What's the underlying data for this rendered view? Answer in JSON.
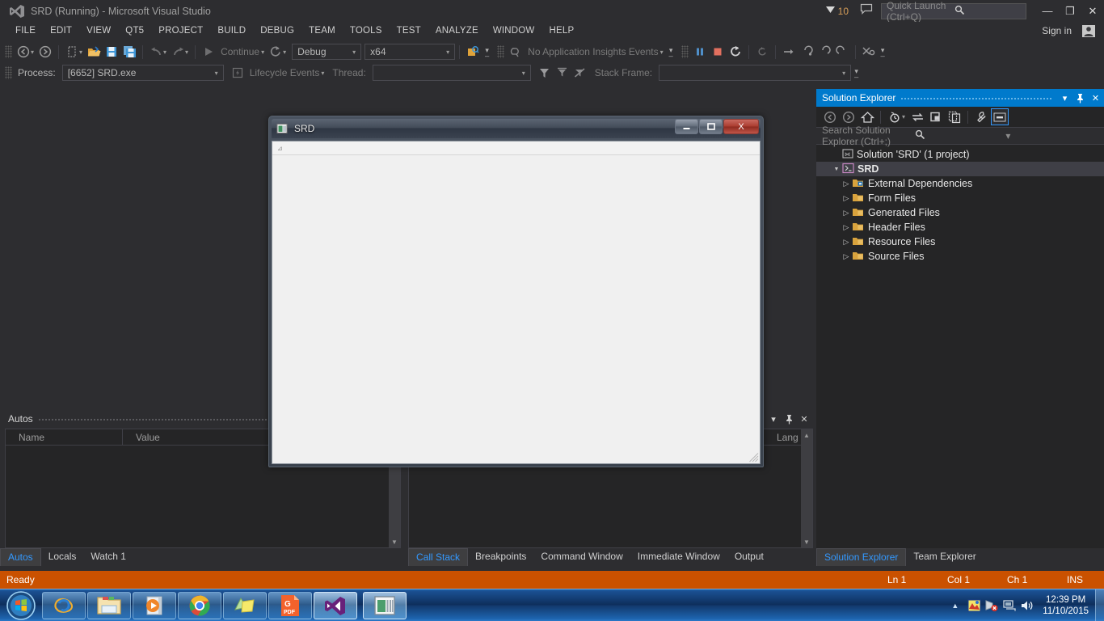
{
  "window": {
    "title": "SRD (Running) - Microsoft Visual Studio",
    "logo_icon": "visual-studio-logo",
    "minimize_label": "—",
    "maximize_label": "❐",
    "close_label": "✕"
  },
  "titlebar_right": {
    "feedback_icon": "megaphone-icon",
    "feedback_count": "10",
    "comment_icon": "comment-icon",
    "quick_launch_placeholder": "Quick Launch (Ctrl+Q)",
    "search_icon": "search-icon"
  },
  "menubar": {
    "items": [
      {
        "label": "FILE"
      },
      {
        "label": "EDIT"
      },
      {
        "label": "VIEW"
      },
      {
        "label": "QT5"
      },
      {
        "label": "PROJECT"
      },
      {
        "label": "BUILD"
      },
      {
        "label": "DEBUG"
      },
      {
        "label": "TEAM"
      },
      {
        "label": "TOOLS"
      },
      {
        "label": "TEST"
      },
      {
        "label": "ANALYZE"
      },
      {
        "label": "WINDOW"
      },
      {
        "label": "HELP"
      }
    ],
    "sign_in": "Sign in",
    "account_icon": "account-icon"
  },
  "toolbar_standard": {
    "nav_back_icon": "navigate-back-icon",
    "nav_forward_icon": "navigate-forward-icon",
    "new_item_icon": "new-item-icon",
    "open_file_icon": "open-file-icon",
    "save_icon": "save-icon",
    "save_all_icon": "save-all-icon",
    "undo_icon": "undo-icon",
    "redo_icon": "redo-icon",
    "run_icon": "play-icon",
    "continue_label": "Continue",
    "restart_icon": "restart-icon",
    "configuration": "Debug",
    "platform": "x64",
    "intellitrace_icon": "intellitrace-icon",
    "app_insights_icon": "app-insights-icon",
    "app_insights_label": "No Application Insights Events",
    "break_all_icon": "pause-icon",
    "stop_debugging_icon": "stop-icon",
    "restart_debug_icon": "restart-debug-icon",
    "show_next_statement_icon": "show-next-statement-icon",
    "step_into_icon": "step-into-icon",
    "step_over_icon": "step-over-icon",
    "step_out_icon": "step-out-icon",
    "thread_marker_icon": "thread-marker-icon",
    "overflow_icon": "toolbar-overflow-icon"
  },
  "toolbar_debug": {
    "process_label": "Process:",
    "process_value": "[6652] SRD.exe",
    "lifecycle_icon": "lifecycle-events-icon",
    "lifecycle_label": "Lifecycle Events",
    "thread_label": "Thread:",
    "thread_value": "",
    "filter_icon": "filter-icon",
    "flag_filter_icon": "flag-filter-icon",
    "no_filter_icon": "no-filter-icon",
    "stack_frame_label": "Stack Frame:",
    "stack_frame_value": ""
  },
  "autos_panel": {
    "title": "Autos",
    "dropdown_icon": "chevron-down-icon",
    "pin_icon": "pin-icon",
    "close_icon": "close-icon",
    "columns": [
      "Name",
      "Value"
    ],
    "rows": []
  },
  "call_stack_panel": {
    "columns": [
      "Lang"
    ],
    "rows": []
  },
  "bottom_tabs_left": {
    "tabs": [
      {
        "label": "Autos",
        "active": true
      },
      {
        "label": "Locals",
        "active": false
      },
      {
        "label": "Watch 1",
        "active": false
      }
    ]
  },
  "bottom_tabs_mid": {
    "tabs": [
      {
        "label": "Call Stack",
        "active": true
      },
      {
        "label": "Breakpoints",
        "active": false
      },
      {
        "label": "Command Window",
        "active": false
      },
      {
        "label": "Immediate Window",
        "active": false
      },
      {
        "label": "Output",
        "active": false
      }
    ]
  },
  "bottom_tabs_right": {
    "tabs": [
      {
        "label": "Solution Explorer",
        "active": true
      },
      {
        "label": "Team Explorer",
        "active": false
      }
    ]
  },
  "solution_explorer": {
    "title": "Solution Explorer",
    "dropdown_icon": "chevron-down-icon",
    "pin_icon": "pin-icon",
    "close_icon": "close-icon",
    "toolbar": {
      "back_icon": "back-icon",
      "forward_icon": "forward-icon",
      "home_icon": "home-icon",
      "pending_changes_icon": "pending-changes-icon",
      "pending_changes_caret": "chevron-down-icon",
      "sync_icon": "sync-with-active-document-icon",
      "refresh_icon": "refresh-icon",
      "show_all_files_icon": "show-all-files-icon",
      "properties_icon": "properties-wrench-icon",
      "preview_icon": "preview-selected-items-icon"
    },
    "search_placeholder": "Search Solution Explorer (Ctrl+;)",
    "search_icon": "search-icon",
    "search_caret_icon": "chevron-down-icon",
    "tree": [
      {
        "label": "Solution 'SRD' (1 project)",
        "icon": "solution-icon",
        "indent": 0,
        "twisty": "",
        "bold": false,
        "selected": false
      },
      {
        "label": "SRD",
        "icon": "cpp-project-icon",
        "indent": 1,
        "twisty": "▲",
        "bold": true,
        "selected": true
      },
      {
        "label": "External Dependencies",
        "icon": "folder-ext-icon",
        "indent": 2,
        "twisty": "▷",
        "bold": false,
        "selected": false
      },
      {
        "label": "Form Files",
        "icon": "folder-icon",
        "indent": 2,
        "twisty": "▷",
        "bold": false,
        "selected": false
      },
      {
        "label": "Generated Files",
        "icon": "folder-icon",
        "indent": 2,
        "twisty": "▷",
        "bold": false,
        "selected": false
      },
      {
        "label": "Header Files",
        "icon": "folder-icon",
        "indent": 2,
        "twisty": "▷",
        "bold": false,
        "selected": false
      },
      {
        "label": "Resource Files",
        "icon": "folder-icon",
        "indent": 2,
        "twisty": "▷",
        "bold": false,
        "selected": false
      },
      {
        "label": "Source Files",
        "icon": "folder-icon",
        "indent": 2,
        "twisty": "▷",
        "bold": false,
        "selected": false
      }
    ]
  },
  "statusbar": {
    "message": "Ready",
    "line": "Ln 1",
    "column": "Col 1",
    "character": "Ch 1",
    "insert_mode": "INS",
    "background_color": "#ca5100"
  },
  "srd_app_window": {
    "title": "SRD",
    "icon": "srd-app-icon",
    "minimize_label": "—",
    "maximize_label": "❐",
    "close_label": "X",
    "client_header_marker": "⊿",
    "client_content": ""
  },
  "taskbar": {
    "start_label": "Start",
    "items": [
      {
        "name": "internet-explorer",
        "active": false
      },
      {
        "name": "windows-explorer",
        "active": false
      },
      {
        "name": "windows-media-player",
        "active": false
      },
      {
        "name": "google-chrome",
        "active": false
      },
      {
        "name": "sticky-notes",
        "active": false
      },
      {
        "name": "pdf-reader",
        "active": false
      },
      {
        "name": "visual-studio",
        "active": true
      },
      {
        "name": "srd-application",
        "active": true
      }
    ],
    "tray": {
      "show_hidden_icon": "chevron-up-icon",
      "icons": [
        "paint-tray-icon",
        "network-error-icon",
        "network-icon",
        "volume-icon"
      ],
      "time": "12:39 PM",
      "date": "11/10/2015"
    }
  }
}
